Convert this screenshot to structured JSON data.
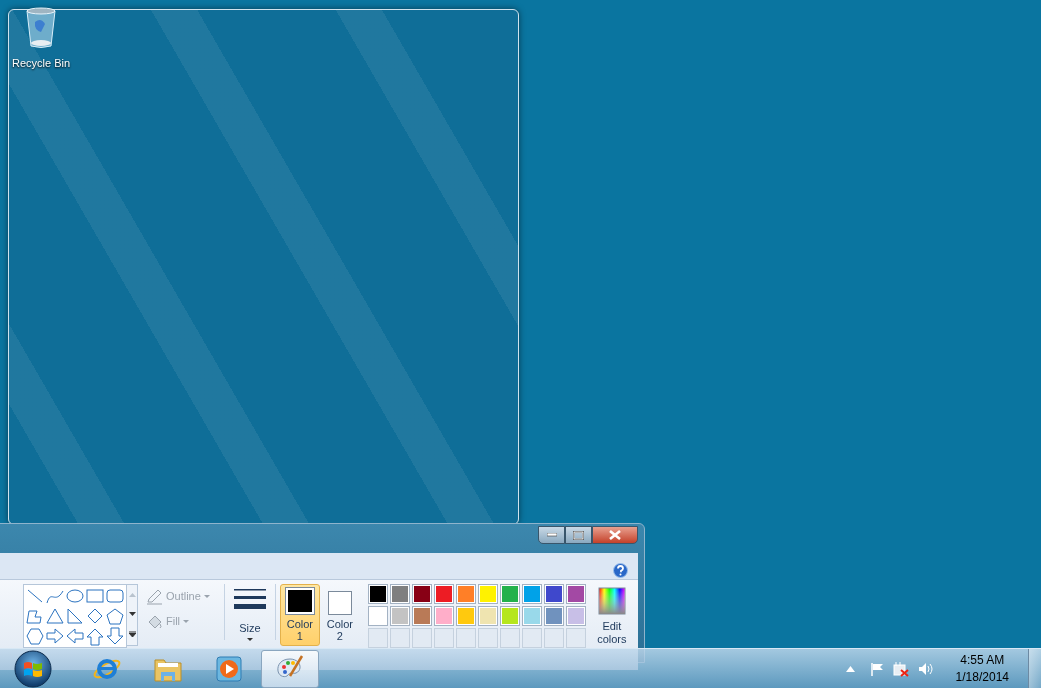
{
  "desktop_icons": [
    {
      "label": "Recycle Bin"
    }
  ],
  "paint_window": {
    "ribbon": {
      "outline": {
        "label": "Outline",
        "disabled": true
      },
      "fill": {
        "label": "Fill",
        "disabled": true
      },
      "size": {
        "label": "Size"
      },
      "color_slots": [
        {
          "label": "Color 1",
          "selected": true,
          "color": "#000000"
        },
        {
          "label": "Color 2",
          "selected": false,
          "color": "#ffffff"
        }
      ],
      "palette": [
        {
          "color": "#000000"
        },
        {
          "color": "#7f7f7f"
        },
        {
          "color": "#880015"
        },
        {
          "color": "#ed1c24"
        },
        {
          "color": "#ff7f27"
        },
        {
          "color": "#fff200"
        },
        {
          "color": "#22b14c"
        },
        {
          "color": "#00a2e8"
        },
        {
          "color": "#3f48cc"
        },
        {
          "color": "#a349a4"
        },
        {
          "color": "#ffffff"
        },
        {
          "color": "#c3c3c3"
        },
        {
          "color": "#b97a57"
        },
        {
          "color": "#ffaec9"
        },
        {
          "color": "#ffc90e"
        },
        {
          "color": "#efe4b0"
        },
        {
          "color": "#b5e61d"
        },
        {
          "color": "#99d9ea"
        },
        {
          "color": "#7092be"
        },
        {
          "color": "#c8bfe7"
        }
      ],
      "edit_colors": {
        "label": "Edit colors"
      }
    }
  },
  "taskbar": {
    "items": [
      {
        "kind": "ie",
        "selected": false
      },
      {
        "kind": "explorer",
        "selected": false
      },
      {
        "kind": "media",
        "selected": false
      },
      {
        "kind": "paint",
        "selected": true
      }
    ],
    "clock": {
      "time": "4:55 AM",
      "date": "1/18/2014"
    }
  }
}
